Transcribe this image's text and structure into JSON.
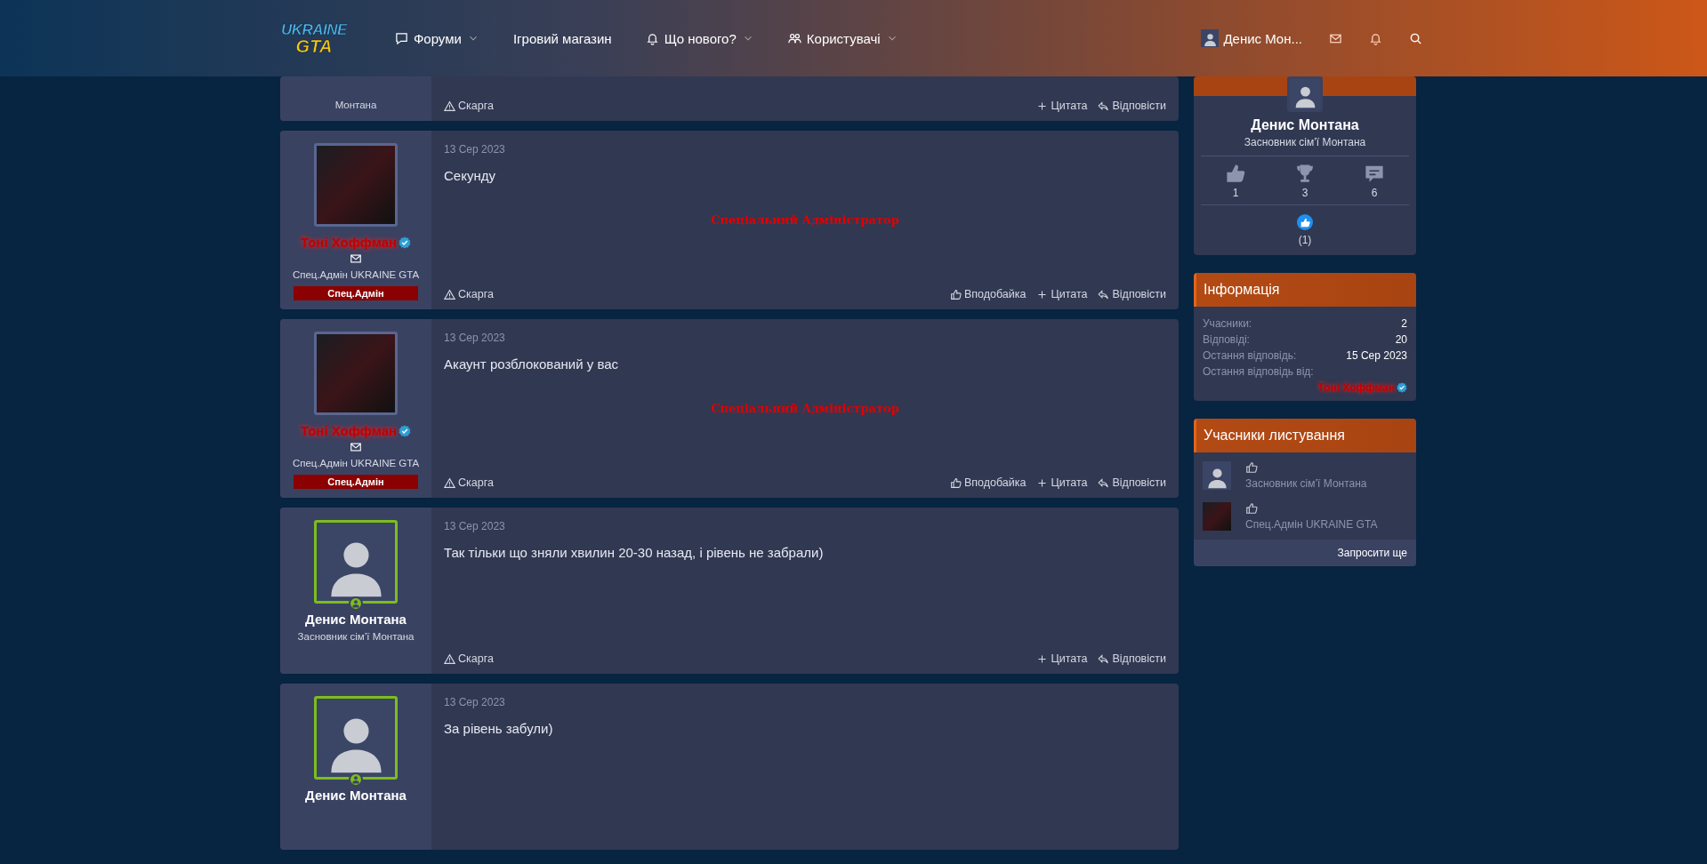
{
  "header": {
    "logo": {
      "top": "UKRAINE",
      "bottom": "GTA"
    },
    "nav": [
      {
        "kind": "chat",
        "label": "Форуми",
        "dropdown": true
      },
      {
        "kind": "plain",
        "label": "Ігровий магазин",
        "dropdown": false
      },
      {
        "kind": "bell",
        "label": "Що нового?",
        "dropdown": true
      },
      {
        "kind": "users",
        "label": "Користувачі",
        "dropdown": true
      }
    ],
    "user": {
      "name": "Денис Мон..."
    }
  },
  "posts": [
    {
      "kind": "partial",
      "role": "Монтана",
      "actions": [
        {
          "kind": "report",
          "label": "Скарга"
        },
        {
          "kind": "quote",
          "label": "Цитата"
        },
        {
          "kind": "reply",
          "label": "Відповісти"
        }
      ]
    },
    {
      "kind": "full",
      "avatar": {
        "kind": "artwork"
      },
      "online": false,
      "author": {
        "kind": "admin",
        "name": "Тоні Хоффман"
      },
      "verified": true,
      "contact": true,
      "role": "Спец.Адмін UKRAINE GTA",
      "badge": "Спец.Адмін",
      "date": "13 Сер 2023",
      "text": "Секунду",
      "signature": "Спеціальний Адміністратор",
      "actions": [
        {
          "kind": "report",
          "label": "Скарга"
        },
        {
          "kind": "like",
          "label": "Вподобайка"
        },
        {
          "kind": "quote",
          "label": "Цитата"
        },
        {
          "kind": "reply",
          "label": "Відповісти"
        }
      ]
    },
    {
      "kind": "full",
      "avatar": {
        "kind": "artwork"
      },
      "online": false,
      "author": {
        "kind": "admin",
        "name": "Тоні Хоффман"
      },
      "verified": true,
      "contact": true,
      "role": "Спец.Адмін UKRAINE GTA",
      "badge": "Спец.Адмін",
      "date": "13 Сер 2023",
      "text": "Акаунт розблокований у вас",
      "signature": "Спеціальний Адміністратор",
      "actions": [
        {
          "kind": "report",
          "label": "Скарга"
        },
        {
          "kind": "like",
          "label": "Вподобайка"
        },
        {
          "kind": "quote",
          "label": "Цитата"
        },
        {
          "kind": "reply",
          "label": "Відповісти"
        }
      ]
    },
    {
      "kind": "full",
      "avatar": {
        "kind": "person"
      },
      "online": true,
      "author": {
        "kind": "member",
        "name": "Денис Монтана"
      },
      "verified": false,
      "contact": false,
      "role": "Засновник сім’ї Монтана",
      "date": "13 Сер 2023",
      "text": "Так тільки що зняли хвилин 20-30 назад, і рівень не забрали)",
      "actions": [
        {
          "kind": "report",
          "label": "Скарга"
        },
        {
          "kind": "quote",
          "label": "Цитата"
        },
        {
          "kind": "reply",
          "label": "Відповісти"
        }
      ]
    },
    {
      "kind": "full",
      "avatar": {
        "kind": "person"
      },
      "online": true,
      "author": {
        "kind": "member",
        "name": "Денис Монтана"
      },
      "verified": false,
      "contact": false,
      "date": "13 Сер 2023",
      "text": "За рівень забули)"
    }
  ],
  "sidebar": {
    "profile": {
      "name": "Денис Монтана",
      "role": "Засновник сім’ї Монтана",
      "stats": [
        {
          "kind": "thumb",
          "value": "1"
        },
        {
          "kind": "trophy",
          "value": "3"
        },
        {
          "kind": "comment",
          "value": "6"
        }
      ],
      "reactions": "(1)"
    },
    "info": {
      "title": "Інформація",
      "rows": [
        {
          "kind": "text",
          "label": "Учасники:",
          "value": "2"
        },
        {
          "kind": "text",
          "label": "Відповіді:",
          "value": "20"
        },
        {
          "kind": "text",
          "label": "Остання відповідь:",
          "value": "15 Сер 2023"
        },
        {
          "kind": "user",
          "label": "Остання відповідь від:",
          "value": "Тоні Хоффман",
          "verified": true
        }
      ]
    },
    "participants": {
      "title": "Учасники листування",
      "items": [
        {
          "avatar": {
            "kind": "person"
          },
          "role": "Засновник сім’ї Монтана"
        },
        {
          "avatar": {
            "kind": "artwork"
          },
          "role": "Спец.Адмін UKRAINE GTA"
        }
      ],
      "invite": "Запросити ще"
    }
  }
}
